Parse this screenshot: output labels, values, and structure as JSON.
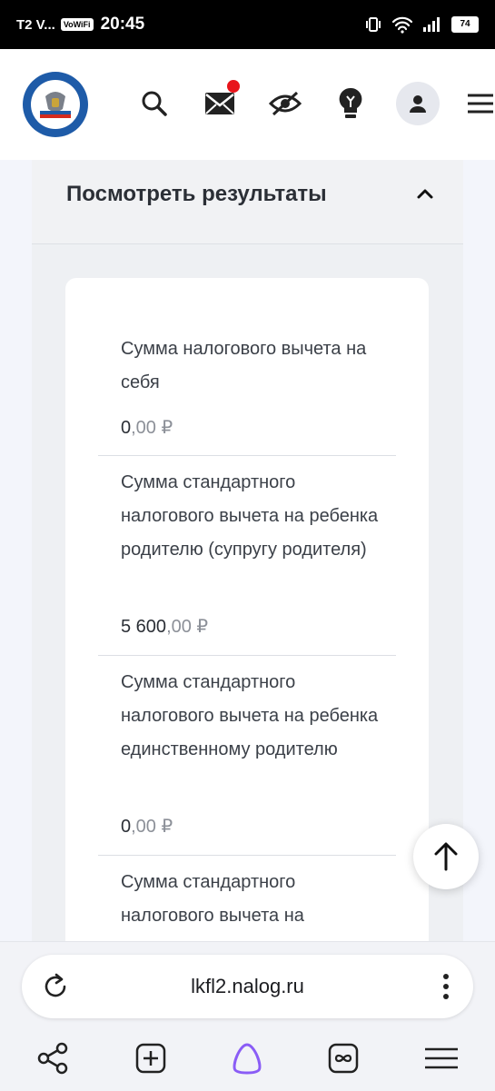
{
  "status_bar": {
    "carrier": "T2 V...",
    "vowifi": "VoWiFi",
    "time": "20:45",
    "battery": "74"
  },
  "header": {
    "icons": [
      "search-icon",
      "mail-icon",
      "hidden-eye-icon",
      "lightbulb-icon",
      "profile-icon",
      "menu-icon"
    ],
    "notification_color": "#e8141b"
  },
  "panel": {
    "title": "Посмотреть результаты",
    "items": [
      {
        "label": "Сумма налогового вычета на себя",
        "value_int": "0",
        "value_dec": ",00 ₽"
      },
      {
        "label": "Сумма стандартного налогового вычета на ребенка родителю (супругу родителя)",
        "value_int": "5 600",
        "value_dec": ",00 ₽"
      },
      {
        "label": "Сумма стандартного налогового вычета на ребенка единственному родителю",
        "value_int": "0",
        "value_dec": ",00 ₽"
      },
      {
        "label": "Сумма стандартного налогового вычета на",
        "value_int": "",
        "value_dec": ""
      }
    ]
  },
  "browser": {
    "url": "lkfl2.nalog.ru",
    "accent": "#8a5cf6"
  }
}
